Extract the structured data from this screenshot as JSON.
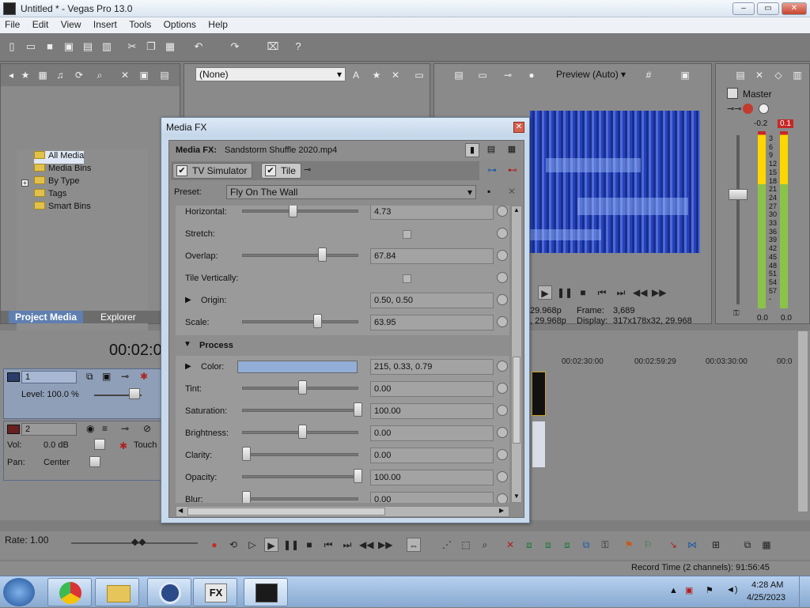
{
  "window": {
    "title": "Untitled * - Vegas Pro 13.0",
    "min": "–",
    "max": "▭",
    "close": "✕"
  },
  "menu": [
    "File",
    "Edit",
    "View",
    "Insert",
    "Tools",
    "Options",
    "Help"
  ],
  "project_media": {
    "tree": [
      "All Media",
      "Media Bins",
      "By Type",
      "Tags",
      "Smart Bins"
    ],
    "tabs": [
      "Project Media",
      "Explorer"
    ],
    "filter": "(None)"
  },
  "preview": {
    "quality": "Preview (Auto)",
    "frame_label": "Frame:",
    "frame_value": "3,689",
    "display_label": "Display:",
    "display_value": "317x178x32, 29.968",
    "rate_a": "29.968p",
    "rate_b": ", 29.968p"
  },
  "master": {
    "title": "Master",
    "peak_left": "-0.2",
    "peak_right": "0.1",
    "scale": [
      "3",
      "6",
      "9",
      "12",
      "15",
      "18",
      "21",
      "24",
      "27",
      "30",
      "33",
      "36",
      "39",
      "42",
      "45",
      "48",
      "51",
      "54",
      "57",
      "-"
    ],
    "bottom_left": "0.0",
    "bottom_right": "0.0"
  },
  "timeline": {
    "timecode": "00:02:0",
    "ruler": [
      "00:02:30:00",
      "00:02:59:29",
      "00:03:30:00",
      "00:0"
    ],
    "video_track": {
      "number": "1",
      "level": "Level: 100.0 %"
    },
    "audio_track": {
      "number": "2",
      "vol_label": "Vol:",
      "vol_value": "0.0 dB",
      "pan_label": "Pan:",
      "pan_value": "Center",
      "touch": "Touch"
    },
    "rate": "Rate: 1.00",
    "record_time": "Record Time (2 channels): 91:56:45"
  },
  "media_fx": {
    "title": "Media FX",
    "header_label": "Media FX:",
    "header_file": "Sandstorm Shuffle 2020.mp4",
    "chain": [
      "TV Simulator",
      "Tile"
    ],
    "preset_label": "Preset:",
    "preset_value": "Fly On The Wall",
    "params": [
      {
        "label": "Horizontal:",
        "value": "4.73",
        "slider": 0.42
      },
      {
        "label": "Stretch:",
        "checkbox": true
      },
      {
        "label": "Overlap:",
        "value": "67.84",
        "slider": 0.68
      },
      {
        "label": "Tile Vertically:",
        "checkbox": true
      },
      {
        "label": "Origin:",
        "value": "0.50, 0.50",
        "expand": true
      },
      {
        "label": "Scale:",
        "value": "63.95",
        "slider": 0.64
      }
    ],
    "section": "Process",
    "process_params": [
      {
        "label": "Color:",
        "value": "215, 0.33, 0.79",
        "color": "#93aed6",
        "expand": true
      },
      {
        "label": "Tint:",
        "value": "0.00",
        "slider": 0.5
      },
      {
        "label": "Saturation:",
        "value": "100.00",
        "slider": 1.0
      },
      {
        "label": "Brightness:",
        "value": "0.00",
        "slider": 0.5
      },
      {
        "label": "Clarity:",
        "value": "0.00",
        "slider": 0.0
      },
      {
        "label": "Opacity:",
        "value": "100.00",
        "slider": 1.0
      },
      {
        "label": "Blur:",
        "value": "0.00",
        "slider": 0.0
      }
    ]
  },
  "taskbar": {
    "time": "4:28 AM",
    "date": "4/25/2023"
  }
}
